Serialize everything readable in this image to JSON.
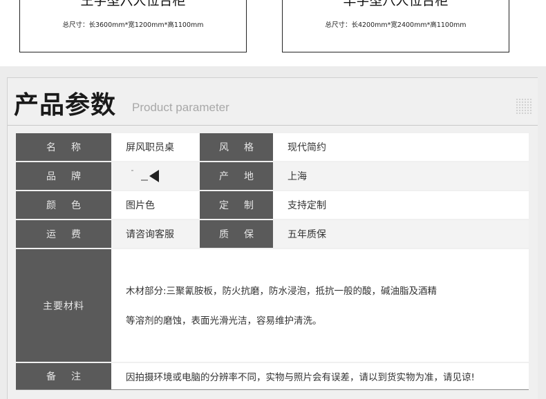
{
  "products": [
    {
      "title": "王字型六人位台柜",
      "size": "总尺寸：长3600mm*宽1200mm*高1100mm"
    },
    {
      "title": "丰字型八人位台柜",
      "size": "总尺寸：长4200mm*宽2400mm*高1100mm"
    }
  ],
  "section": {
    "title_zh": "产品参数",
    "title_en": "Product parameter"
  },
  "params": {
    "name_label": "名称",
    "name_value": "屏风职员桌",
    "style_label": "风格",
    "style_value": "现代简约",
    "brand_label": "品牌",
    "origin_label": "产地",
    "origin_value": "上海",
    "color_label": "颜色",
    "color_value": "图片色",
    "custom_label": "定制",
    "custom_value": "支持定制",
    "shipping_label": "运费",
    "shipping_value": "请咨询客服",
    "warranty_label": "质保",
    "warranty_value": "五年质保",
    "material_label": "主要材料",
    "material_line1": "木材部分:三聚氰胺板，防火抗磨，防水浸泡，抵抗一般的酸，碱油脂及酒精",
    "material_line2": "等溶剂的磨蚀，表面光滑光洁，容易维护清洗。",
    "note_label": "备注",
    "note_value": "因拍摄环境或电脑的分辨率不同，实物与照片会有误差，请以到货实物为准，请见谅!"
  }
}
